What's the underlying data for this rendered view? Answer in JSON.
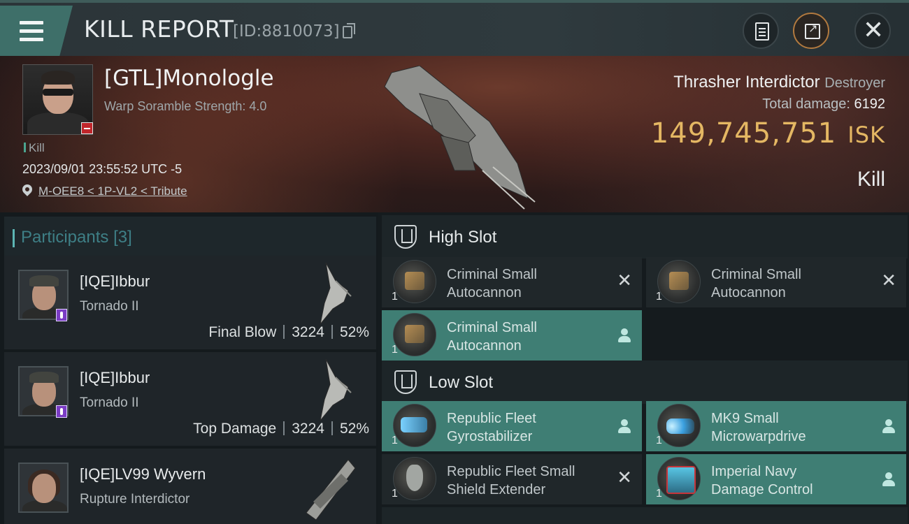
{
  "header": {
    "title": "KILL REPORT",
    "id_label": "[ID:8810073]",
    "menu_icon": "menu-icon",
    "actions": [
      "clipboard-icon",
      "share-icon",
      "close-icon"
    ]
  },
  "victim": {
    "name": "[GTL]Monologle",
    "scramble": "Warp Soramble Strength: 4.0",
    "kill_tag": "Kill",
    "timestamp": "2023/09/01 23:55:52 UTC -5",
    "location": "M-OEE8 < 1P-VL2 < Tribute",
    "ship_name": "Thrasher Interdictor",
    "ship_class": "Destroyer",
    "total_damage_label": "Total damage:",
    "total_damage": "6192",
    "isk_value": "149,745,751",
    "isk_unit": "ISK",
    "result": "Kill"
  },
  "participants": {
    "title": "Participants",
    "count": "[3]",
    "rows": [
      {
        "name": "[IQE]Ibbur",
        "ship": "Tornado II",
        "role": "Final Blow",
        "damage": "3224",
        "percent": "52%"
      },
      {
        "name": "[IQE]Ibbur",
        "ship": "Tornado II",
        "role": "Top Damage",
        "damage": "3224",
        "percent": "52%"
      },
      {
        "name": "[IQE]LV99 Wyvern",
        "ship": "Rupture Interdictor"
      }
    ]
  },
  "fitting": {
    "high_slot_label": "High Slot",
    "low_slot_label": "Low Slot",
    "high": [
      {
        "qty": "1",
        "name_l1": "Criminal Small",
        "name_l2": "Autocannon",
        "status": "destroyed"
      },
      {
        "qty": "1",
        "name_l1": "Criminal Small",
        "name_l2": "Autocannon",
        "status": "destroyed"
      },
      {
        "qty": "1",
        "name_l1": "Criminal Small",
        "name_l2": "Autocannon",
        "status": "dropped"
      }
    ],
    "low": [
      {
        "qty": "1",
        "name_l1": "Republic Fleet",
        "name_l2": "Gyrostabilizer",
        "status": "dropped"
      },
      {
        "qty": "1",
        "name_l1": "MK9 Small",
        "name_l2": "Microwarpdrive",
        "status": "dropped"
      },
      {
        "qty": "1",
        "name_l1": "Republic Fleet Small",
        "name_l2": "Shield Extender",
        "status": "destroyed"
      },
      {
        "qty": "1",
        "name_l1": "Imperial Navy",
        "name_l2": "Damage Control",
        "status": "dropped"
      }
    ]
  },
  "colors": {
    "accent_teal": "#3f7e74",
    "isk_gold": "#e4b763",
    "badge_red": "#c0262b",
    "badge_purple": "#7a3cc4"
  }
}
